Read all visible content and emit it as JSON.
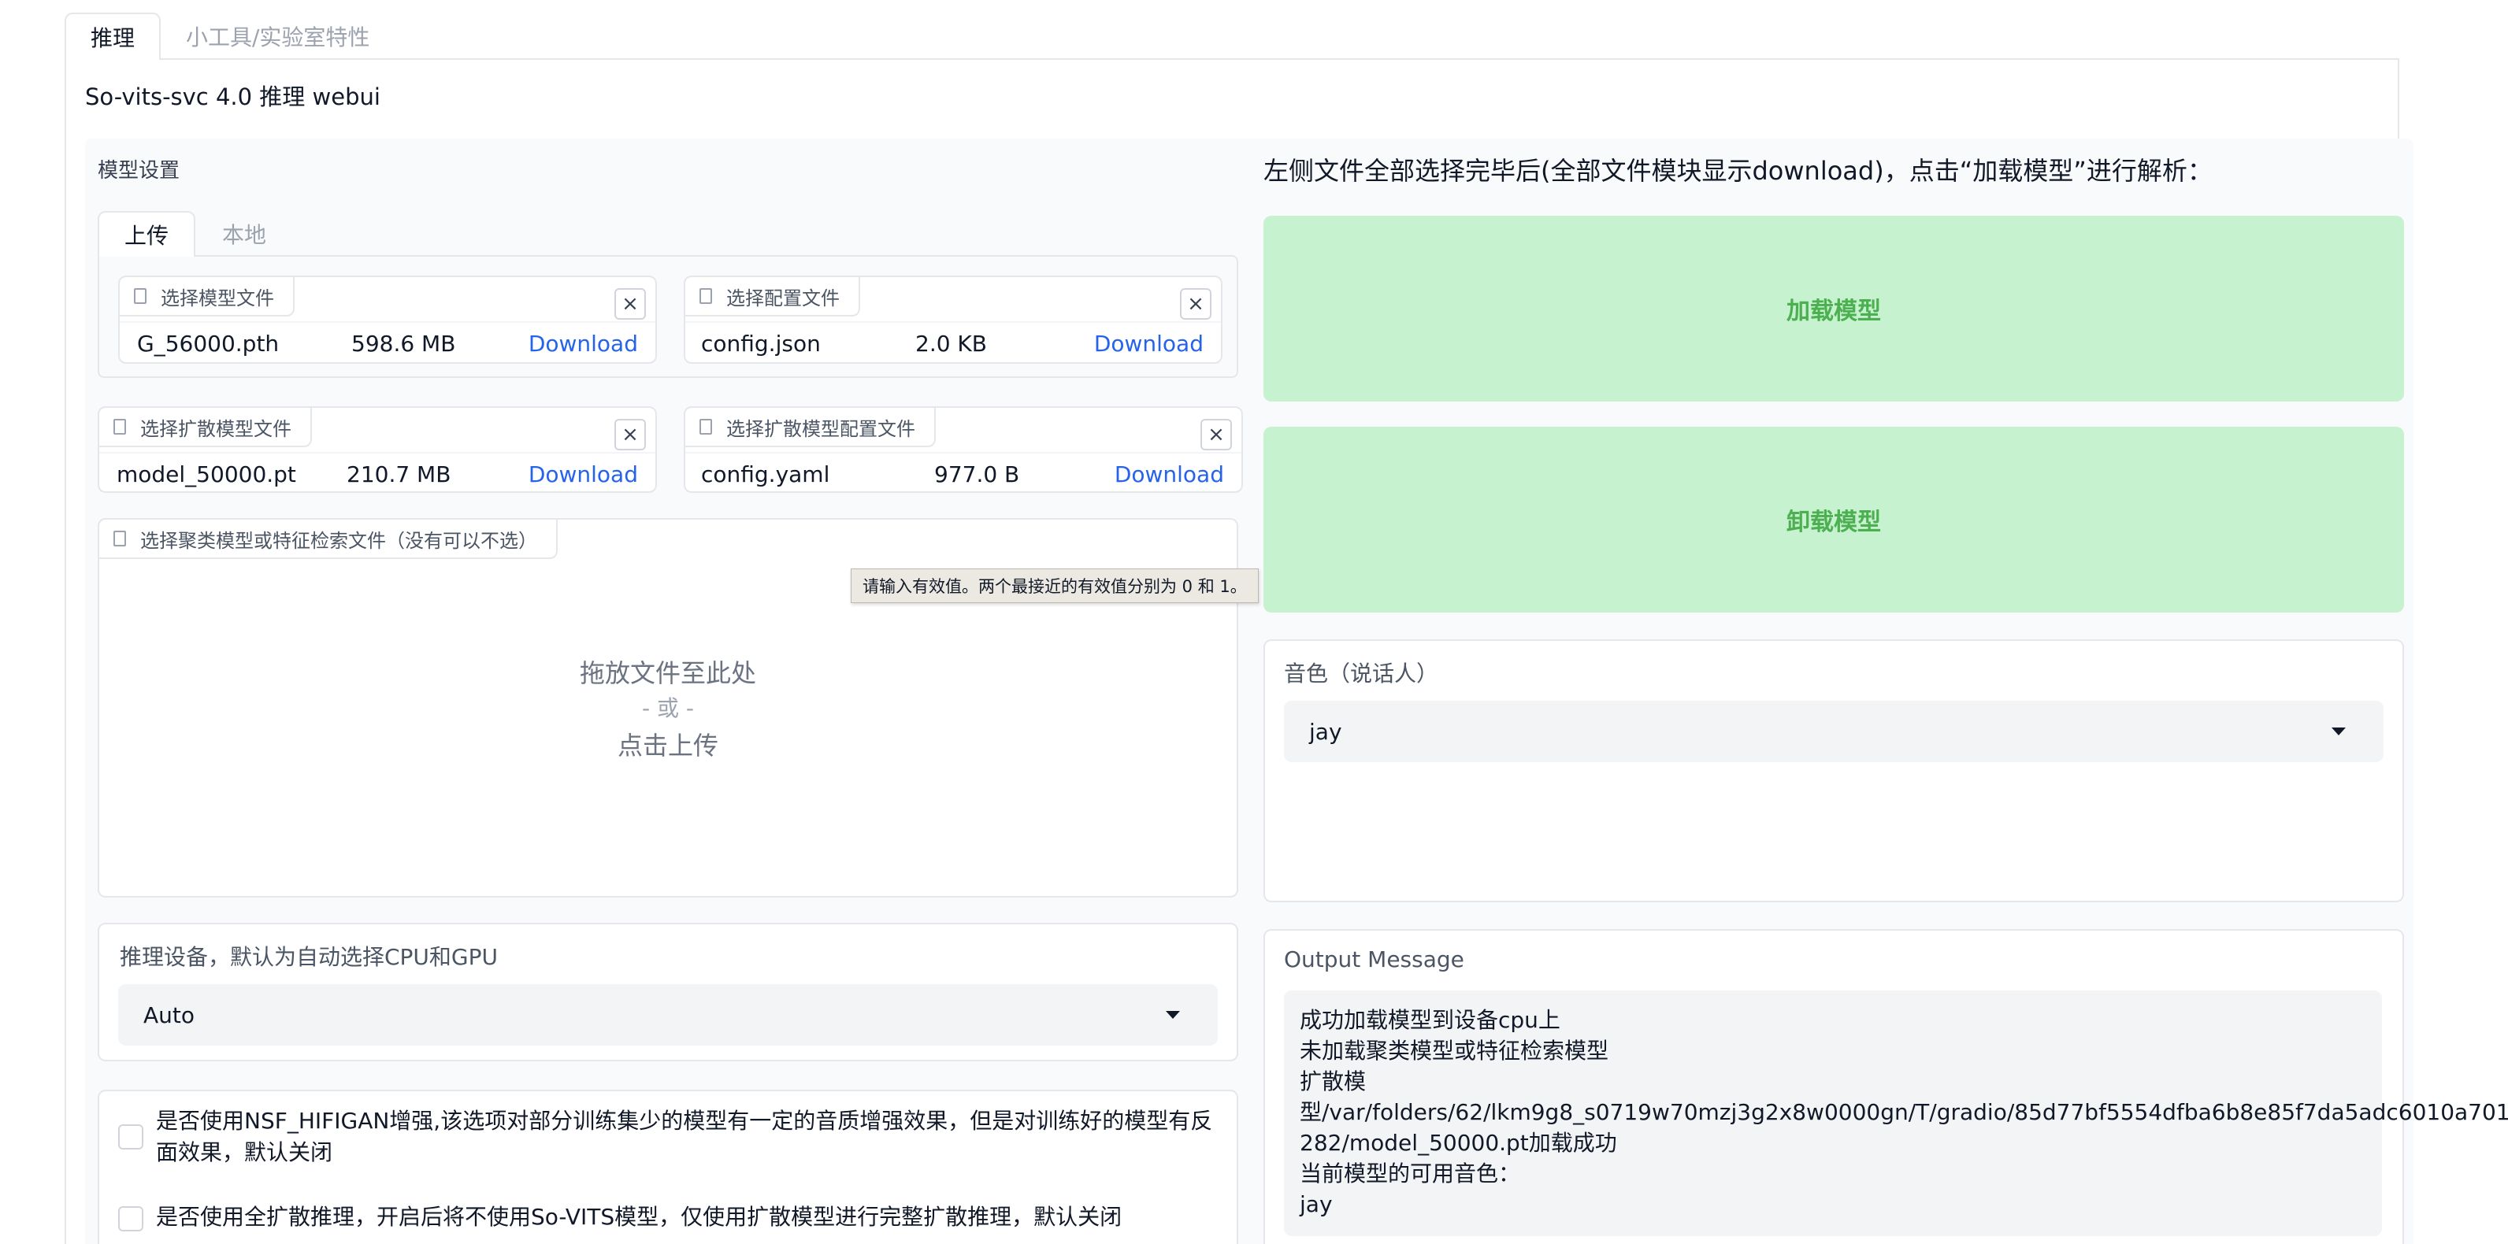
{
  "top_tabs": [
    "推理",
    "小工具/实验室特性"
  ],
  "app_title": "So-vits-svc 4.0 推理 webui",
  "model_settings": {
    "label": "模型设置",
    "upload_tabs": [
      "上传",
      "本地"
    ],
    "files": [
      {
        "label": "选择模型文件",
        "name": "G_56000.pth",
        "size": "598.6 MB",
        "link": "Download",
        "close": "×"
      },
      {
        "label": "选择配置文件",
        "name": "config.json",
        "size": "2.0 KB",
        "link": "Download",
        "close": "×"
      },
      {
        "label": "选择扩散模型文件",
        "name": "model_50000.pt",
        "size": "210.7 MB",
        "link": "Download",
        "close": "×"
      },
      {
        "label": "选择扩散模型配置文件",
        "name": "config.yaml",
        "size": "977.0 B",
        "link": "Download",
        "close": "×"
      }
    ],
    "cluster_upload": {
      "label": "选择聚类模型或特征检索文件（没有可以不选）",
      "drop_line1": "拖放文件至此处",
      "drop_line2": "- 或 -",
      "drop_line3": "点击上传"
    },
    "tooltip": "请输入有效值。两个最接近的有效值分别为 0 和 1。"
  },
  "device": {
    "label": "推理设备，默认为自动选择CPU和GPU",
    "value": "Auto"
  },
  "options": [
    {
      "line1": "是否使用NSF_HIFIGAN增强,该选项对部分训练集少的模型有一定的音质增强效果，但是对训练好的模型有反",
      "line2": "面效果，默认关闭"
    },
    {
      "line1": "是否使用全扩散推理，开启后将不使用So-VITS模型，仅使用扩散模型进行完整扩散推理，默认关闭",
      "line2": ""
    }
  ],
  "right": {
    "heading": "左侧文件全部选择完毕后(全部文件模块显示download)，点击“加载模型”进行解析：",
    "load_button": "加载模型",
    "unload_button": "卸载模型",
    "speaker": {
      "label": "音色（说话人）",
      "value": "jay"
    },
    "output": {
      "label": "Output Message",
      "lines": [
        "成功加载模型到设备cpu上",
        "未加载聚类模型或特征检索模型",
        "扩散模",
        "型/var/folders/62/lkm9g8_s0719w70mzj3g2x8w0000gn/T/gradio/85d77bf5554dfba6b8e85f7da5adc6010a701",
        "282/model_50000.pt加载成功",
        "当前模型的可用音色：",
        "jay"
      ]
    }
  }
}
